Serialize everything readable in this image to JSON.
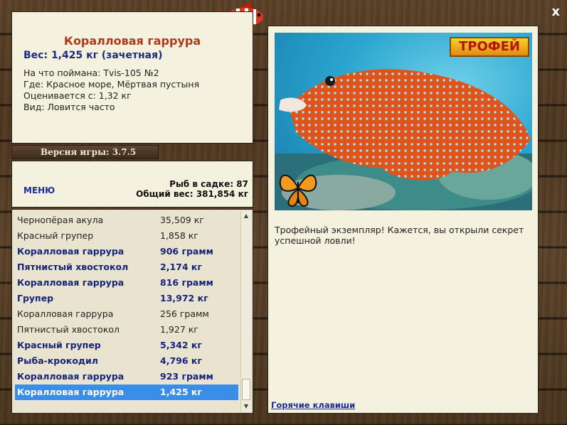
{
  "window": {
    "close_label": "x"
  },
  "catch": {
    "title": "Коралловая гарруpa",
    "weight": "Вес: 1,425 кг (зачетная)",
    "caught_on": "На что поймана: Tvis-105 №2",
    "location": "Где: Красное море, Мёртвая пустыня",
    "valued_from": "Оценивается с: 1,32 кг",
    "kind": "Вид: Ловится часто"
  },
  "game_version": "Версия игры: 3.7.5",
  "menu_label": "МЕНЮ",
  "stats": {
    "fish_in_keepnet": "Рыб в садке: 87",
    "total_weight": "Общий вес: 381,854 кг"
  },
  "fish_list": [
    {
      "name": "Чернопёрая акула",
      "weight": "35,509 кг",
      "style": "normal"
    },
    {
      "name": "Красный групер",
      "weight": "1,858 кг",
      "style": "normal"
    },
    {
      "name": "Коралловая гарруpa",
      "weight": "906 грамм",
      "style": "bold"
    },
    {
      "name": "Пятнистый хвостокол",
      "weight": "2,174 кг",
      "style": "bold"
    },
    {
      "name": "Коралловая гарруpa",
      "weight": "816 грамм",
      "style": "bold"
    },
    {
      "name": "Групер",
      "weight": "13,972 кг",
      "style": "bold"
    },
    {
      "name": "Коралловая гарруpa",
      "weight": "256 грамм",
      "style": "normal"
    },
    {
      "name": "Пятнистый хвостокол",
      "weight": "1,927 кг",
      "style": "normal"
    },
    {
      "name": "Красный групер",
      "weight": "5,342 кг",
      "style": "bold"
    },
    {
      "name": "Рыба-крокодил",
      "weight": "4,796 кг",
      "style": "bold"
    },
    {
      "name": "Коралловая гарруpa",
      "weight": "923 грамм",
      "style": "bold"
    },
    {
      "name": "Коралловая гарруpa",
      "weight": "1,425 кг",
      "style": "selected"
    }
  ],
  "trophy_badge": "ТРОФЕЙ",
  "trophy_text": "Трофейный экземпляр! Кажется, вы открыли секрет успешной ловли!",
  "hotkeys_link": "Горячие клавиши",
  "colors": {
    "accent_blue": "#1b2c86",
    "title_red": "#b0391b",
    "selection": "#3b8ee8",
    "panel": "#f4f1df"
  }
}
